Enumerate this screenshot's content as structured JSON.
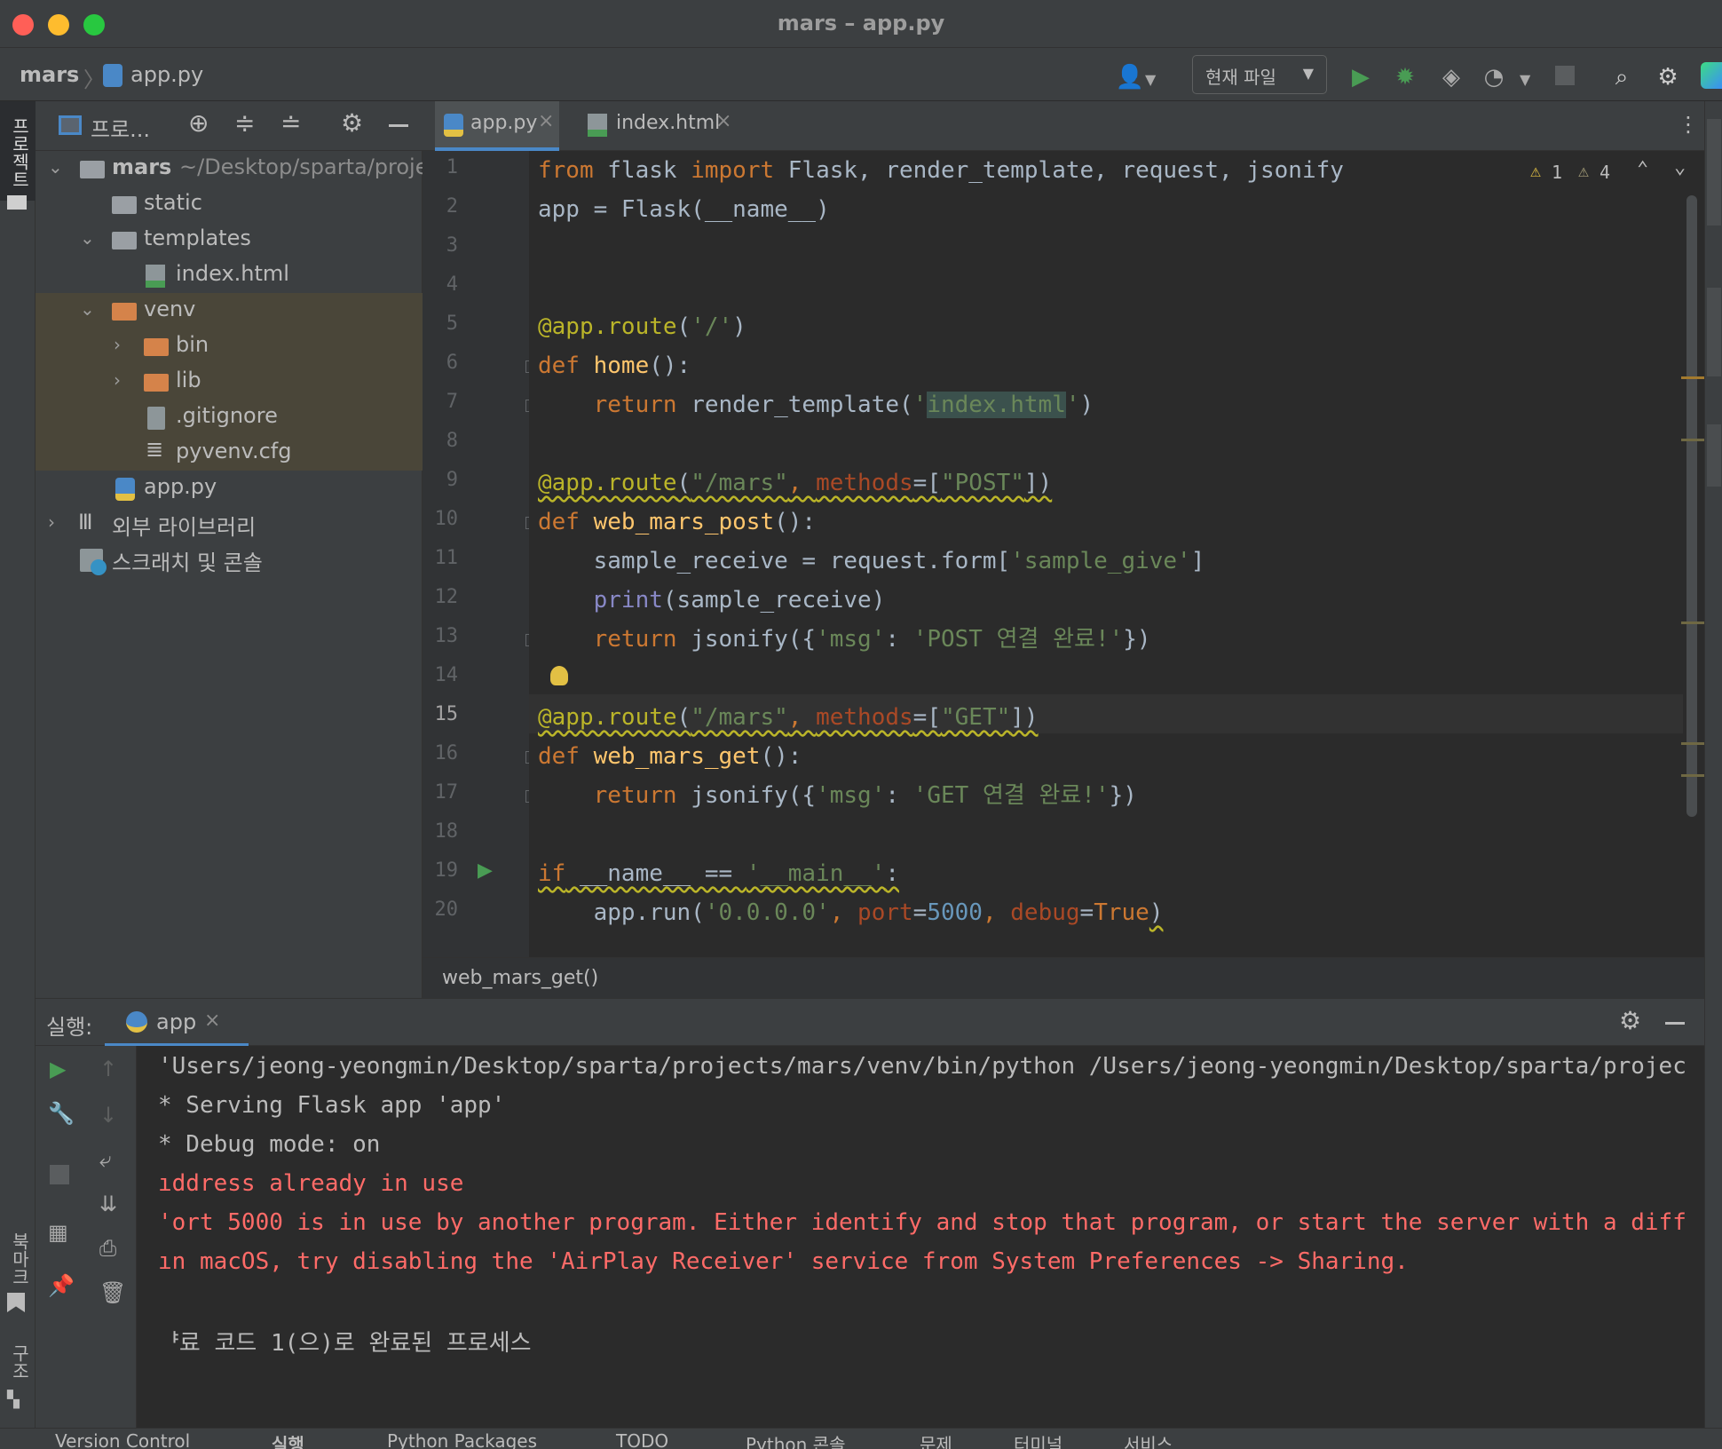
{
  "window": {
    "title": "mars – app.py"
  },
  "navbar": {
    "project": "mars",
    "file": "app.py",
    "run_config": "현재 파일"
  },
  "project_panel": {
    "title": "프로...",
    "tree": [
      {
        "label": "mars",
        "path": "~/Desktop/sparta/proje"
      },
      {
        "label": "static"
      },
      {
        "label": "templates"
      },
      {
        "label": "index.html"
      },
      {
        "label": "venv"
      },
      {
        "label": "bin"
      },
      {
        "label": "lib"
      },
      {
        "label": ".gitignore"
      },
      {
        "label": "pyvenv.cfg"
      },
      {
        "label": "app.py"
      },
      {
        "label": "외부 라이브러리"
      },
      {
        "label": "스크래치 및 콘솔"
      }
    ]
  },
  "left_strip": {
    "project_tab": "프로젝트",
    "bookmark_tab": "북마크",
    "structure_tab": "구조"
  },
  "editor": {
    "tabs": [
      {
        "label": "app.py",
        "active": true
      },
      {
        "label": "index.html",
        "active": false
      }
    ],
    "warnings": {
      "weak": "1",
      "warn": "4"
    },
    "line_numbers": [
      "1",
      "2",
      "3",
      "4",
      "5",
      "6",
      "7",
      "8",
      "9",
      "10",
      "11",
      "12",
      "13",
      "14",
      "15",
      "16",
      "17",
      "18",
      "19",
      "20"
    ],
    "current_line": 15,
    "breadcrumb": "web_mars_get()"
  },
  "code": {
    "l1_from": "from",
    "l1_mod": " flask ",
    "l1_import": "import",
    "l1_rest": " Flask, render_template, request, jsonify",
    "l2": "app = Flask(__name__)",
    "l5_dec": "@app.route",
    "l5_rest": "(",
    "l5_str": "'/'",
    "l5_end": ")",
    "l6_def": "def",
    "l6_fn": " home",
    "l6_rest": "():",
    "l7_ret": "    return",
    "l7_mid": " render_template(",
    "l7_q1": "'",
    "l7_str": "index.html",
    "l7_q2": "'",
    "l7_end": ")",
    "l9_dec": "@app.route",
    "l9_p": "(",
    "l9_str": "\"/mars\"",
    "l9_c": ", ",
    "l9_kw": "methods",
    "l9_eq": "=[",
    "l9_m": "\"POST\"",
    "l9_end": "])",
    "l10_def": "def",
    "l10_fn": " web_mars_post",
    "l10_rest": "():",
    "l11_a": "    sample_receive = request.form[",
    "l11_str": "'sample_give'",
    "l11_end": "]",
    "l12_sp": "    ",
    "l12_print": "print",
    "l12_rest": "(sample_receive)",
    "l13_ret": "    return",
    "l13_mid": " jsonify({",
    "l13_k": "'msg'",
    "l13_c": ": ",
    "l13_v": "'POST 연결 완료!'",
    "l13_end": "})",
    "l15_dec": "@app.route",
    "l15_p": "(",
    "l15_str": "\"/mars\"",
    "l15_c": ", ",
    "l15_kw": "methods",
    "l15_eq": "=[",
    "l15_m": "\"GET\"",
    "l15_end": "])",
    "l16_def": "def",
    "l16_fn": " web_mars_get",
    "l16_rest": "():",
    "l17_ret": "    return",
    "l17_mid": " jsonify({",
    "l17_k": "'msg'",
    "l17_c": ": ",
    "l17_v": "'GET 연결 완료!'",
    "l17_end": "})",
    "l19_if": "if",
    "l19_mid": " __name__ == ",
    "l19_str": "'__main__'",
    "l19_end": ":",
    "l20_a": "    app.run(",
    "l20_s": "'0.0.0.0'",
    "l20_c1": ", ",
    "l20_p1": "port",
    "l20_eq1": "=",
    "l20_n": "5000",
    "l20_c2": ", ",
    "l20_p2": "debug",
    "l20_eq2": "=",
    "l20_t": "True",
    "l20_end": ")"
  },
  "run_panel": {
    "label": "실행:",
    "tab": "app",
    "console": [
      {
        "text": "'Users/jeong-yeongmin/Desktop/sparta/projects/mars/venv/bin/python /Users/jeong-yeongmin/Desktop/sparta/projec",
        "error": false
      },
      {
        "text": "* Serving Flask app 'app'",
        "error": false
      },
      {
        "text": "* Debug mode: on",
        "error": false
      },
      {
        "text": "ıddress already in use",
        "error": true
      },
      {
        "text": "'ort 5000 is in use by another program. Either identify and stop that program, or start the server with a diff",
        "error": true
      },
      {
        "text": "ın macOS, try disabling the 'AirPlay Receiver' service from System Preferences -> Sharing.",
        "error": true
      },
      {
        "text": "ᅣ료 코드 1(으)로 완료된 프로세스",
        "error": false
      }
    ]
  },
  "statusbar": {
    "items": [
      "Version Control",
      "실행",
      "Python Packages",
      "TODO",
      "Python 콘솔",
      "문제",
      "터미널",
      "서비스"
    ]
  },
  "colors": {
    "background": "#2b2b2b",
    "panel": "#3c3f41",
    "keyword": "#cc7832",
    "string": "#6a8759",
    "decorator": "#bbb529",
    "function": "#ffc66d",
    "error": "#ff6b68",
    "run_green": "#499c54"
  }
}
